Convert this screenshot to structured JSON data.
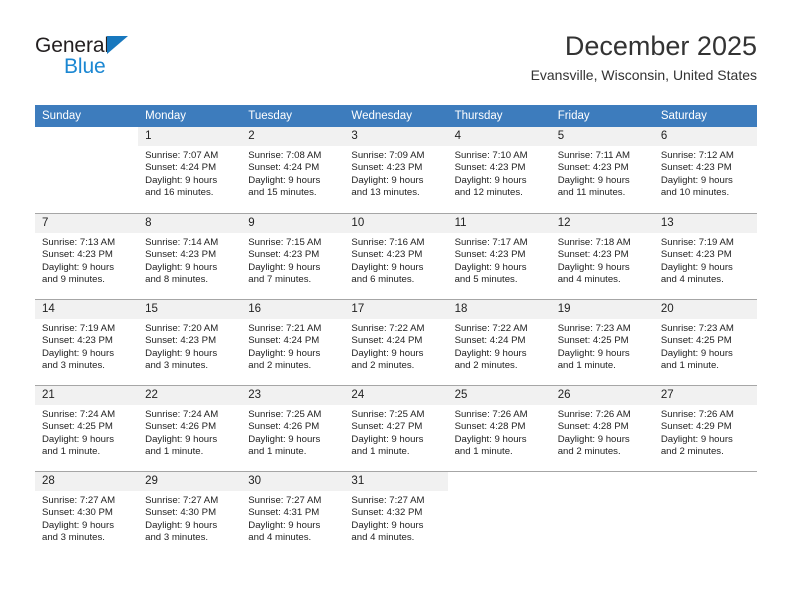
{
  "brand": {
    "name_part1": "General",
    "name_part2": "Blue",
    "triangle_icon": "triangle-icon",
    "color_dark": "#231f20",
    "color_blue": "#1b87d2"
  },
  "header": {
    "title": "December 2025",
    "subtitle": "Evansville, Wisconsin, United States",
    "header_bg": "#3d7cbd",
    "daynum_bg": "#f1f1f1"
  },
  "weekdays": [
    "Sunday",
    "Monday",
    "Tuesday",
    "Wednesday",
    "Thursday",
    "Friday",
    "Saturday"
  ],
  "weeks": [
    [
      {
        "day": "",
        "sunrise": "",
        "sunset": "",
        "daylight1": "",
        "daylight2": ""
      },
      {
        "day": "1",
        "sunrise": "Sunrise: 7:07 AM",
        "sunset": "Sunset: 4:24 PM",
        "daylight1": "Daylight: 9 hours",
        "daylight2": "and 16 minutes."
      },
      {
        "day": "2",
        "sunrise": "Sunrise: 7:08 AM",
        "sunset": "Sunset: 4:24 PM",
        "daylight1": "Daylight: 9 hours",
        "daylight2": "and 15 minutes."
      },
      {
        "day": "3",
        "sunrise": "Sunrise: 7:09 AM",
        "sunset": "Sunset: 4:23 PM",
        "daylight1": "Daylight: 9 hours",
        "daylight2": "and 13 minutes."
      },
      {
        "day": "4",
        "sunrise": "Sunrise: 7:10 AM",
        "sunset": "Sunset: 4:23 PM",
        "daylight1": "Daylight: 9 hours",
        "daylight2": "and 12 minutes."
      },
      {
        "day": "5",
        "sunrise": "Sunrise: 7:11 AM",
        "sunset": "Sunset: 4:23 PM",
        "daylight1": "Daylight: 9 hours",
        "daylight2": "and 11 minutes."
      },
      {
        "day": "6",
        "sunrise": "Sunrise: 7:12 AM",
        "sunset": "Sunset: 4:23 PM",
        "daylight1": "Daylight: 9 hours",
        "daylight2": "and 10 minutes."
      }
    ],
    [
      {
        "day": "7",
        "sunrise": "Sunrise: 7:13 AM",
        "sunset": "Sunset: 4:23 PM",
        "daylight1": "Daylight: 9 hours",
        "daylight2": "and 9 minutes."
      },
      {
        "day": "8",
        "sunrise": "Sunrise: 7:14 AM",
        "sunset": "Sunset: 4:23 PM",
        "daylight1": "Daylight: 9 hours",
        "daylight2": "and 8 minutes."
      },
      {
        "day": "9",
        "sunrise": "Sunrise: 7:15 AM",
        "sunset": "Sunset: 4:23 PM",
        "daylight1": "Daylight: 9 hours",
        "daylight2": "and 7 minutes."
      },
      {
        "day": "10",
        "sunrise": "Sunrise: 7:16 AM",
        "sunset": "Sunset: 4:23 PM",
        "daylight1": "Daylight: 9 hours",
        "daylight2": "and 6 minutes."
      },
      {
        "day": "11",
        "sunrise": "Sunrise: 7:17 AM",
        "sunset": "Sunset: 4:23 PM",
        "daylight1": "Daylight: 9 hours",
        "daylight2": "and 5 minutes."
      },
      {
        "day": "12",
        "sunrise": "Sunrise: 7:18 AM",
        "sunset": "Sunset: 4:23 PM",
        "daylight1": "Daylight: 9 hours",
        "daylight2": "and 4 minutes."
      },
      {
        "day": "13",
        "sunrise": "Sunrise: 7:19 AM",
        "sunset": "Sunset: 4:23 PM",
        "daylight1": "Daylight: 9 hours",
        "daylight2": "and 4 minutes."
      }
    ],
    [
      {
        "day": "14",
        "sunrise": "Sunrise: 7:19 AM",
        "sunset": "Sunset: 4:23 PM",
        "daylight1": "Daylight: 9 hours",
        "daylight2": "and 3 minutes."
      },
      {
        "day": "15",
        "sunrise": "Sunrise: 7:20 AM",
        "sunset": "Sunset: 4:23 PM",
        "daylight1": "Daylight: 9 hours",
        "daylight2": "and 3 minutes."
      },
      {
        "day": "16",
        "sunrise": "Sunrise: 7:21 AM",
        "sunset": "Sunset: 4:24 PM",
        "daylight1": "Daylight: 9 hours",
        "daylight2": "and 2 minutes."
      },
      {
        "day": "17",
        "sunrise": "Sunrise: 7:22 AM",
        "sunset": "Sunset: 4:24 PM",
        "daylight1": "Daylight: 9 hours",
        "daylight2": "and 2 minutes."
      },
      {
        "day": "18",
        "sunrise": "Sunrise: 7:22 AM",
        "sunset": "Sunset: 4:24 PM",
        "daylight1": "Daylight: 9 hours",
        "daylight2": "and 2 minutes."
      },
      {
        "day": "19",
        "sunrise": "Sunrise: 7:23 AM",
        "sunset": "Sunset: 4:25 PM",
        "daylight1": "Daylight: 9 hours",
        "daylight2": "and 1 minute."
      },
      {
        "day": "20",
        "sunrise": "Sunrise: 7:23 AM",
        "sunset": "Sunset: 4:25 PM",
        "daylight1": "Daylight: 9 hours",
        "daylight2": "and 1 minute."
      }
    ],
    [
      {
        "day": "21",
        "sunrise": "Sunrise: 7:24 AM",
        "sunset": "Sunset: 4:25 PM",
        "daylight1": "Daylight: 9 hours",
        "daylight2": "and 1 minute."
      },
      {
        "day": "22",
        "sunrise": "Sunrise: 7:24 AM",
        "sunset": "Sunset: 4:26 PM",
        "daylight1": "Daylight: 9 hours",
        "daylight2": "and 1 minute."
      },
      {
        "day": "23",
        "sunrise": "Sunrise: 7:25 AM",
        "sunset": "Sunset: 4:26 PM",
        "daylight1": "Daylight: 9 hours",
        "daylight2": "and 1 minute."
      },
      {
        "day": "24",
        "sunrise": "Sunrise: 7:25 AM",
        "sunset": "Sunset: 4:27 PM",
        "daylight1": "Daylight: 9 hours",
        "daylight2": "and 1 minute."
      },
      {
        "day": "25",
        "sunrise": "Sunrise: 7:26 AM",
        "sunset": "Sunset: 4:28 PM",
        "daylight1": "Daylight: 9 hours",
        "daylight2": "and 1 minute."
      },
      {
        "day": "26",
        "sunrise": "Sunrise: 7:26 AM",
        "sunset": "Sunset: 4:28 PM",
        "daylight1": "Daylight: 9 hours",
        "daylight2": "and 2 minutes."
      },
      {
        "day": "27",
        "sunrise": "Sunrise: 7:26 AM",
        "sunset": "Sunset: 4:29 PM",
        "daylight1": "Daylight: 9 hours",
        "daylight2": "and 2 minutes."
      }
    ],
    [
      {
        "day": "28",
        "sunrise": "Sunrise: 7:27 AM",
        "sunset": "Sunset: 4:30 PM",
        "daylight1": "Daylight: 9 hours",
        "daylight2": "and 3 minutes."
      },
      {
        "day": "29",
        "sunrise": "Sunrise: 7:27 AM",
        "sunset": "Sunset: 4:30 PM",
        "daylight1": "Daylight: 9 hours",
        "daylight2": "and 3 minutes."
      },
      {
        "day": "30",
        "sunrise": "Sunrise: 7:27 AM",
        "sunset": "Sunset: 4:31 PM",
        "daylight1": "Daylight: 9 hours",
        "daylight2": "and 4 minutes."
      },
      {
        "day": "31",
        "sunrise": "Sunrise: 7:27 AM",
        "sunset": "Sunset: 4:32 PM",
        "daylight1": "Daylight: 9 hours",
        "daylight2": "and 4 minutes."
      },
      {
        "day": "",
        "sunrise": "",
        "sunset": "",
        "daylight1": "",
        "daylight2": ""
      },
      {
        "day": "",
        "sunrise": "",
        "sunset": "",
        "daylight1": "",
        "daylight2": ""
      },
      {
        "day": "",
        "sunrise": "",
        "sunset": "",
        "daylight1": "",
        "daylight2": ""
      }
    ]
  ]
}
